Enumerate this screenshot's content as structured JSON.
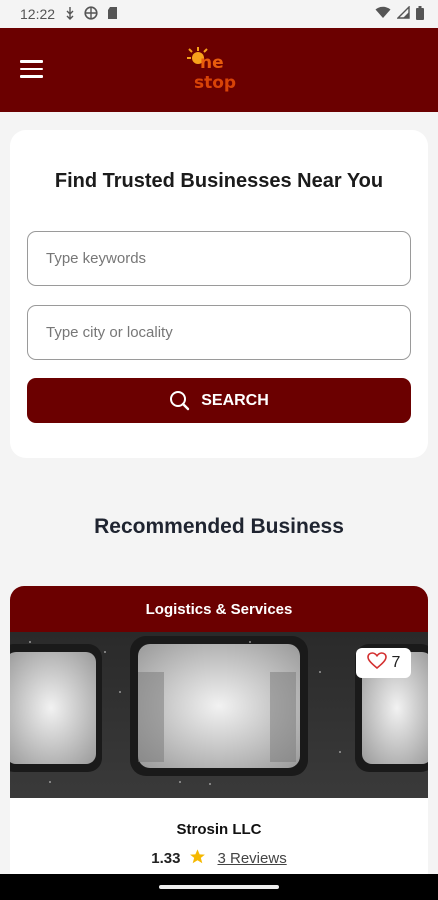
{
  "status_bar": {
    "time": "12:22",
    "icons": [
      "usb-debug-icon",
      "vpn-globe-icon",
      "sd-card-icon",
      "wifi-icon",
      "signal-icon",
      "battery-icon"
    ]
  },
  "app_bar": {
    "menu_icon": "hamburger-menu-icon",
    "logo_text": "One stop",
    "colors": {
      "brand": "#6b0000",
      "logo": "#e85c0d"
    }
  },
  "search": {
    "title": "Find Trusted Businesses Near You",
    "keywords_placeholder": "Type keywords",
    "keywords_value": "",
    "city_placeholder": "Type city or locality",
    "city_value": "",
    "button_label": "SEARCH",
    "button_icon": "search-icon"
  },
  "recommended": {
    "section_title": "Recommended Business",
    "businesses": [
      {
        "category": "Logistics & Services",
        "name": "Strosin LLC",
        "likes": "7",
        "rating": "1.33",
        "reviews": "3 Reviews"
      }
    ]
  }
}
